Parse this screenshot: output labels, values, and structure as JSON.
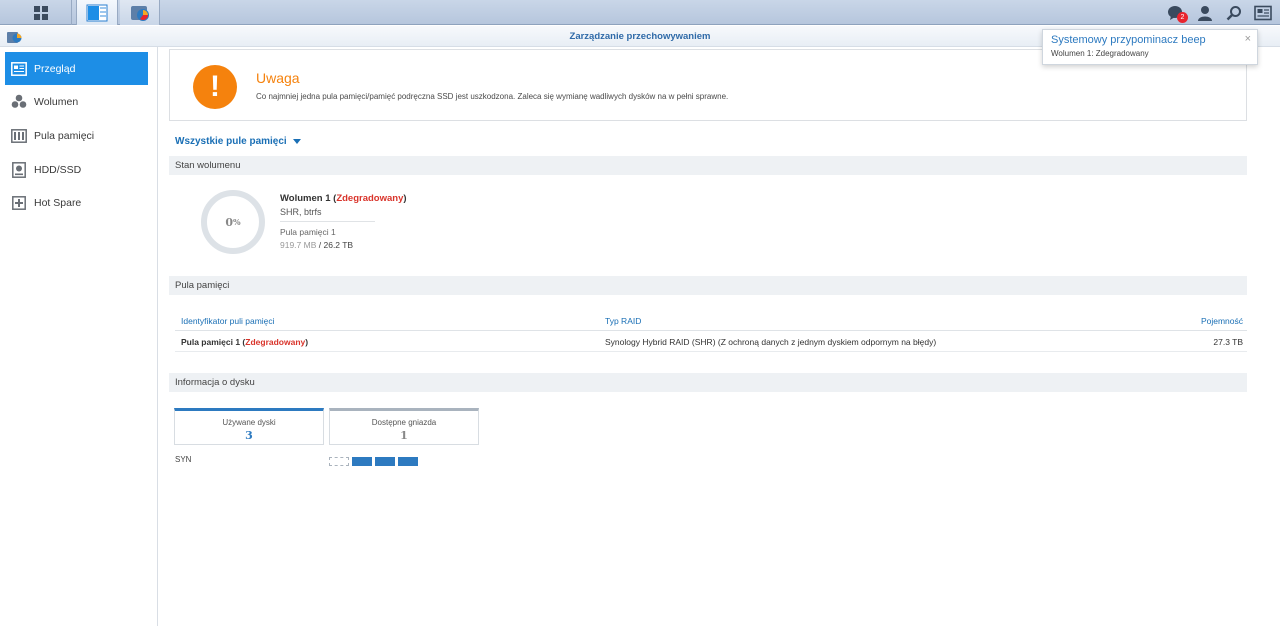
{
  "taskbar": {
    "main_menu_icon": "main-menu-icon",
    "apps": [
      {
        "name": "storage-manager-icon",
        "active": true
      },
      {
        "name": "app-icon",
        "active": false
      }
    ],
    "notification_count": "2",
    "right_icons": [
      "notification-icon",
      "user-icon",
      "search-icon",
      "widgets-icon"
    ]
  },
  "window": {
    "title": "Zarządzanie przechowywaniem"
  },
  "sidebar": {
    "items": [
      {
        "label": "Przegląd",
        "icon": "overview-icon",
        "active": true
      },
      {
        "label": "Wolumen",
        "icon": "volume-icon",
        "active": false
      },
      {
        "label": "Pula pamięci",
        "icon": "storage-pool-icon",
        "active": false
      },
      {
        "label": "HDD/SSD",
        "icon": "hdd-icon",
        "active": false
      },
      {
        "label": "Hot Spare",
        "icon": "hot-spare-icon",
        "active": false
      }
    ]
  },
  "alert": {
    "icon_symbol": "!",
    "title": "Uwaga",
    "message": "Co najmniej jedna pula pamięci/pamięć podręczna SSD jest uszkodzona. Zaleca się wymianę wadliwych dysków na w pełni sprawne."
  },
  "pool_filter": {
    "label": "Wszystkie pule pamięci"
  },
  "volume_status": {
    "header": "Stan wolumenu",
    "usage_value": "0",
    "usage_unit": "%",
    "name": "Wolumen 1",
    "status": "Zdegradowany",
    "type": "SHR, btrfs",
    "pool": "Pula pamięci 1",
    "used": "919.7 MB",
    "separator": " / ",
    "total": "26.2 TB"
  },
  "storage_pool": {
    "header": "Pula pamięci",
    "columns": [
      "Identyfikator puli pamięci",
      "Typ RAID",
      "Pojemność"
    ],
    "rows": [
      {
        "id": "Pula pamięci 1",
        "status": "Zdegradowany",
        "raid": "Synology Hybrid RAID (SHR) (Z ochroną danych z jednym dyskiem odpornym na błędy)",
        "capacity": "27.3 TB"
      }
    ]
  },
  "disk_info": {
    "header": "Informacja o dysku",
    "used_label": "Używane dyski",
    "used_count": "3",
    "free_label": "Dostępne gniazda",
    "free_count": "1",
    "device_label": "SYN",
    "slots": [
      "empty",
      "used",
      "used",
      "used"
    ]
  },
  "notification": {
    "title": "Systemowy przypominacz beep",
    "message": "Wolumen 1: Zdegradowany",
    "close_symbol": "×"
  },
  "colors": {
    "accent": "#1d8ee6",
    "warning": "#f5820d",
    "degraded": "#d9342b",
    "link": "#1a6fb5"
  }
}
